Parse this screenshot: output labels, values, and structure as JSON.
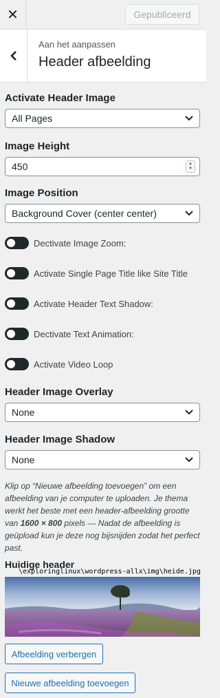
{
  "topbar": {
    "close_glyph": "✕",
    "publish_label": "Gepubliceerd"
  },
  "section": {
    "breadcrumb": "Aan het aanpassen",
    "title": "Header afbeelding"
  },
  "fields": {
    "activate_header_image": {
      "label": "Activate Header Image",
      "value": "All Pages"
    },
    "image_height": {
      "label": "Image Height",
      "value": "450"
    },
    "image_position": {
      "label": "Image Position",
      "value": "Background Cover (center center)"
    },
    "toggles": [
      {
        "label": "Dectivate Image Zoom:"
      },
      {
        "label": "Activate Single Page Title like Site Title"
      },
      {
        "label": "Activate Header Text Shadow:"
      },
      {
        "label": "Dectivate Text Animation:"
      },
      {
        "label": "Activate Video Loop"
      }
    ],
    "overlay": {
      "label": "Header Image Overlay",
      "value": "None"
    },
    "shadow": {
      "label": "Header Image Shadow",
      "value": "None"
    }
  },
  "description": {
    "part1": "Klip op “Nieuwe afbeelding toevoegen” om een afbeelding van je computer te uploaden. Je thema werkt het beste met een header-afbeelding grootte van ",
    "size": "1600 × 800",
    "part2": " pixels — Nadat de afbeelding is geüpload kun je deze nog bijsnijden zodat het perfect past."
  },
  "current_header": {
    "label": "Huidige header",
    "path": "\\exploringlinux\\wordpress-allx\\img\\heide.jpg"
  },
  "buttons": {
    "hide": "Afbeelding verbergen",
    "add_new": "Nieuwe afbeelding toevoegen"
  },
  "colors": {
    "accent": "#2271b1",
    "toggle": "#1e2a28"
  },
  "icons": {
    "close": "close-icon",
    "back": "chevron-left-icon",
    "dropdown": "chevron-down-icon"
  }
}
